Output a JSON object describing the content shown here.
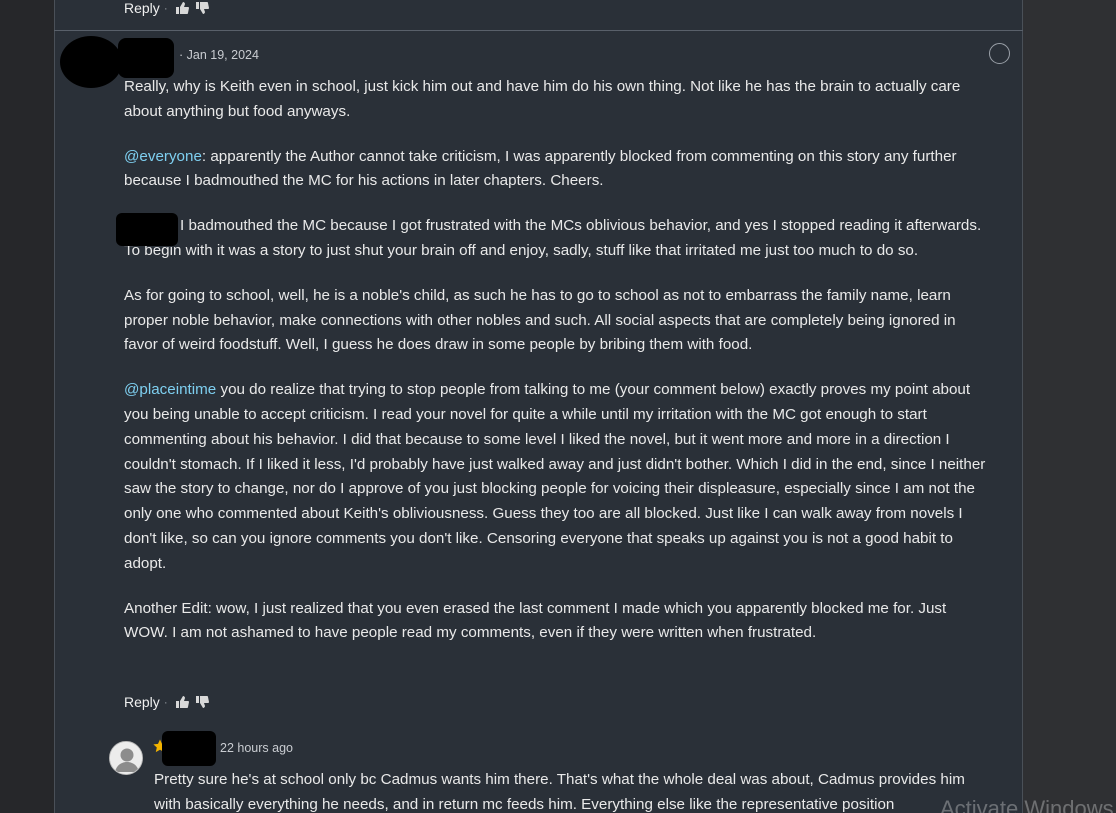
{
  "top_actions": {
    "reply_label": "Reply",
    "separator": "·"
  },
  "comment": {
    "date": "· Jan 19, 2024",
    "paragraphs": {
      "p1": "Really, why is Keith even in school, just kick him out and have him do his own thing. Not like he has the brain to actually care about anything but food anyways.",
      "p2_mention": "@everyone",
      "p2_rest": ": apparently the Author cannot take criticism, I was apparently blocked from commenting on this story any further because I badmouthed the MC for his actions in later chapters. Cheers.",
      "p3": "I badmouthed the MC because I got frustrated with the MCs oblivious behavior, and yes I stopped reading it afterwards. To begin with it was a story to just shut your brain off and enjoy, sadly, stuff like that irritated me just too much to do so.",
      "p4": "As for going to school, well, he is a noble's child, as such he has to go to school as not to embarrass the family name, learn proper noble behavior, make connections with other nobles and such. All social aspects that are completely being ignored in favor of weird foodstuff. Well, I guess he does draw in some people by bribing them with food.",
      "p5_mention": "@placeintime",
      "p5_rest": " you do realize that trying to stop people from talking to me (your comment below) exactly proves my point about you being unable to accept criticism. I read your novel for quite a while until my irritation with the MC got enough to start commenting about his behavior. I did that because to some level I liked the novel, but it went more and more in a direction I couldn't stomach. If I liked it less, I'd probably have just walked away and just didn't bother. Which I did in the end, since I neither saw the story to change, nor do I approve of you just blocking people for voicing their displeasure, especially since I am not the only one who commented about Keith's obliviousness. Guess they too are all blocked. Just like I can walk away from novels I don't like, so can you ignore comments you don't like. Censoring everyone that speaks up against you is not a good habit to adopt.",
      "p6": "Another Edit: wow, I just realized that you even erased the last comment I made which you apparently blocked me for. Just WOW. I am not ashamed to have people read my comments, even if they were written when frustrated."
    },
    "reply_label": "Reply",
    "separator": "·"
  },
  "reply": {
    "date": "22 hours ago",
    "text": "Pretty sure he's at school only bc Cadmus wants him there. That's what the whole deal was about, Cadmus provides him with basically everything he needs, and in return mc feeds him. Everything else like the representative position"
  },
  "watermark": "Activate Windows",
  "colors": {
    "panel": "#2a3038",
    "mention": "#7ecff0",
    "background": "#2b2c2e"
  }
}
